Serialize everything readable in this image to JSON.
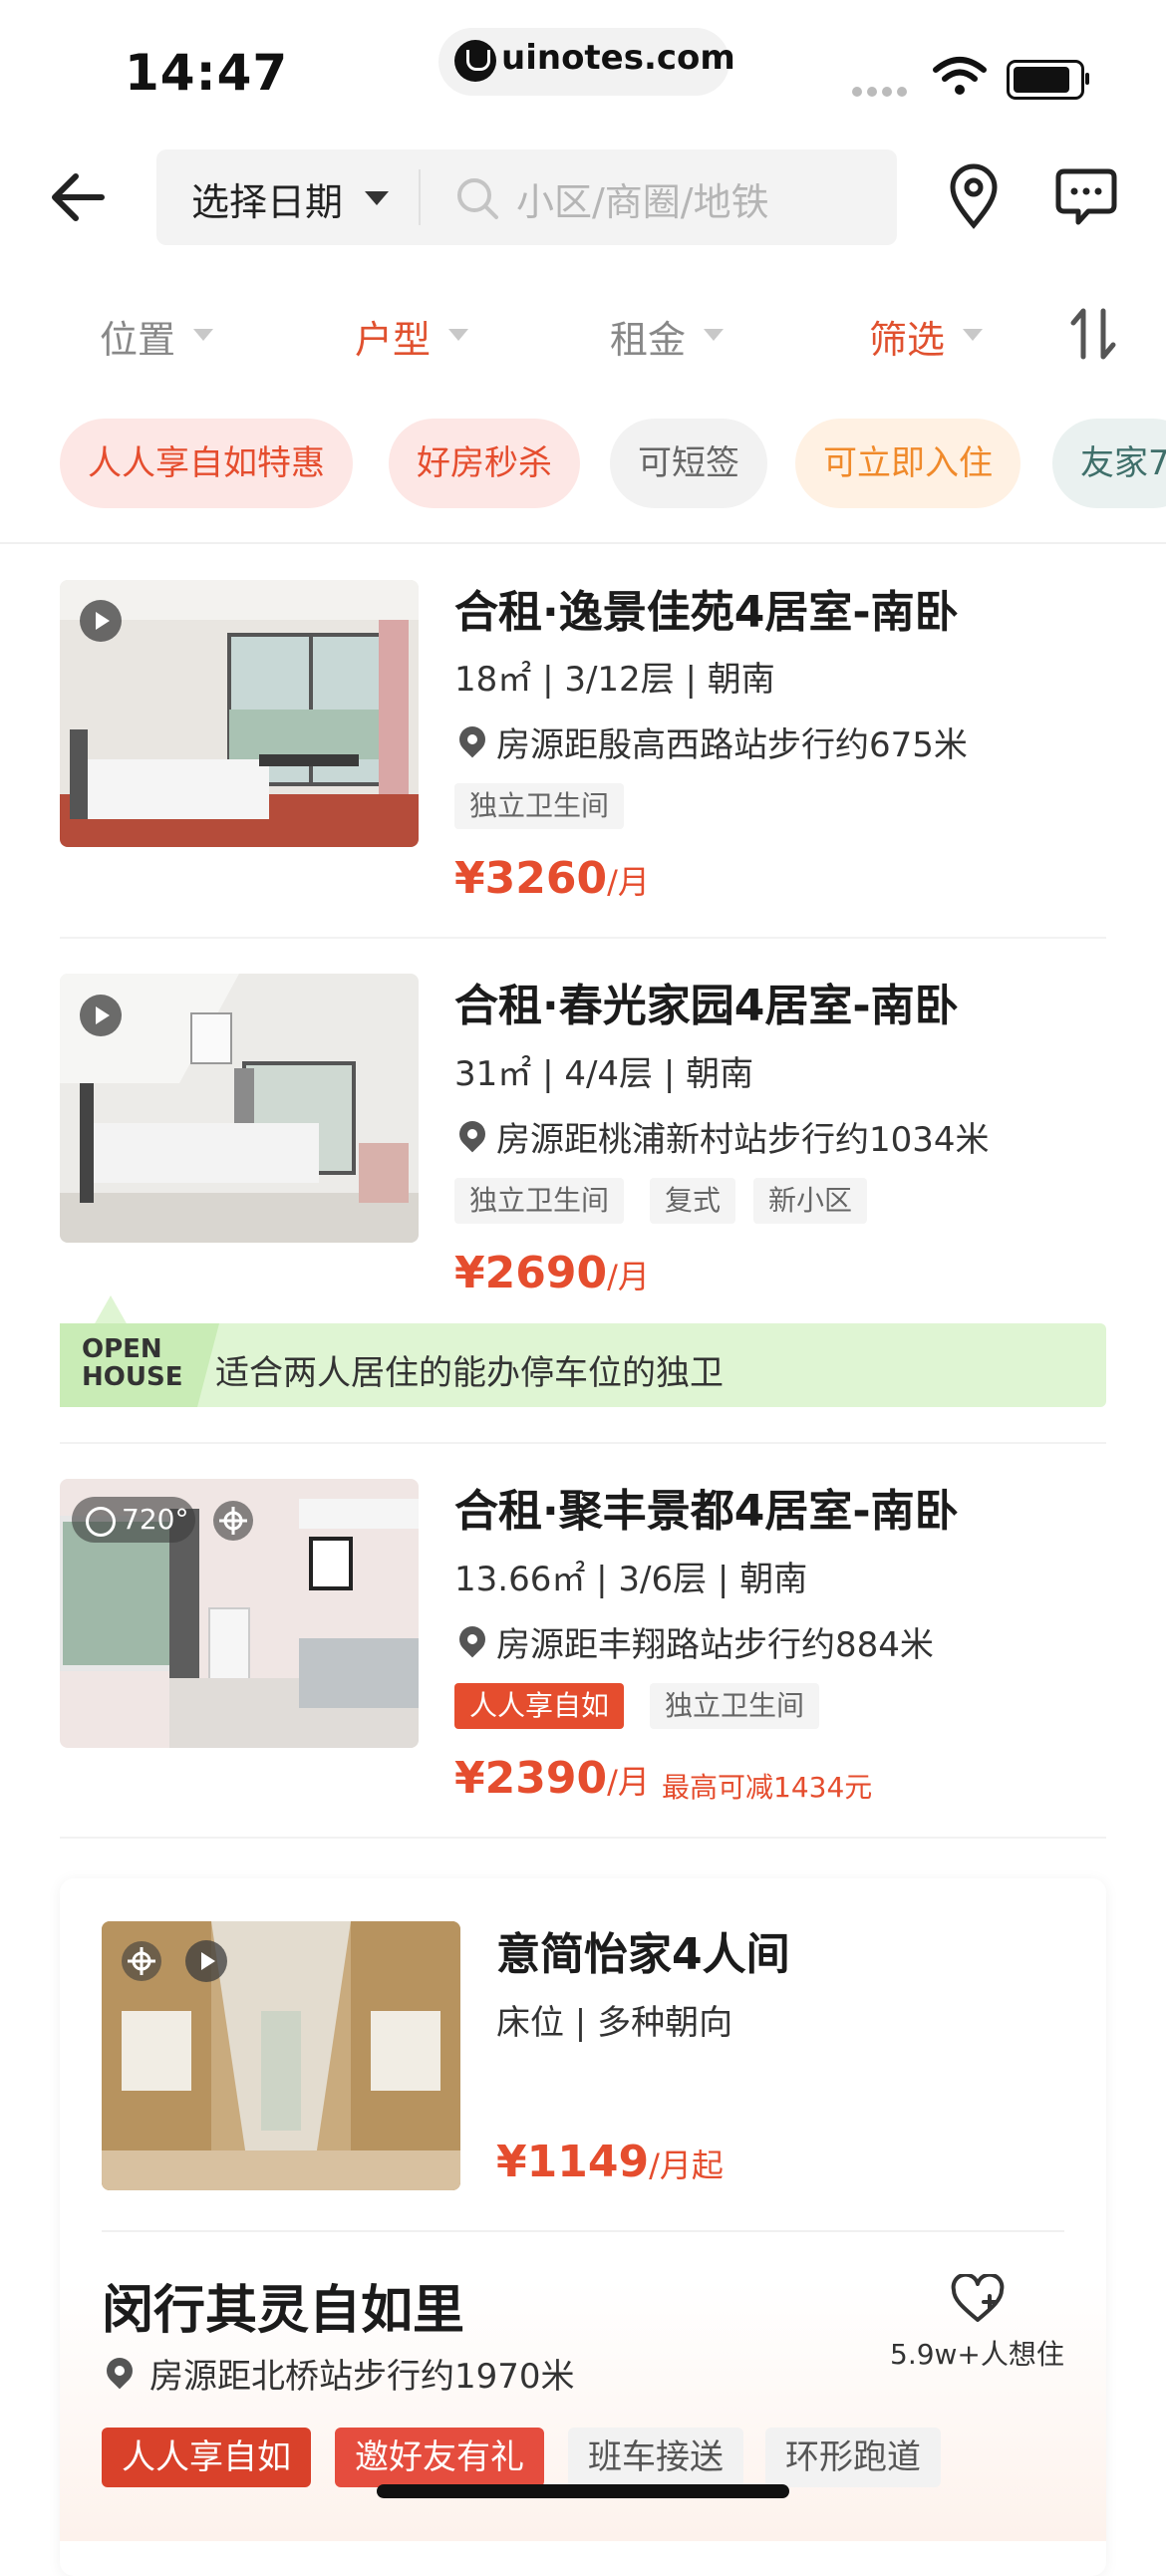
{
  "status": {
    "time": "14:47",
    "url": "uinotes.com"
  },
  "search": {
    "date_label": "选择日期",
    "placeholder": "小区/商圈/地铁"
  },
  "filters": [
    {
      "label": "位置",
      "color": "#888888"
    },
    {
      "label": "户型",
      "color": "#e0512f"
    },
    {
      "label": "租金",
      "color": "#888888"
    },
    {
      "label": "筛选",
      "color": "#e0512f"
    }
  ],
  "chips": [
    {
      "label": "人人享自如特惠",
      "bg": "#fde7e5",
      "fg": "#e54d2e"
    },
    {
      "label": "好房秒杀",
      "bg": "#fde7e5",
      "fg": "#e54d2e"
    },
    {
      "label": "可短签",
      "bg": "#f2f2f2",
      "fg": "#666666"
    },
    {
      "label": "可立即入住",
      "bg": "#fff1e3",
      "fg": "#f08a2b"
    },
    {
      "label": "友家7",
      "bg": "#eaf1f0",
      "fg": "#3f6f6a"
    }
  ],
  "listings": [
    {
      "title": "合租·逸景佳苑4居室-南卧",
      "spec": "18㎡ | 3/12层 | 朝南",
      "location": "房源距殷高西路站步行约675米",
      "tags": [
        "独立卫生间"
      ],
      "price": "¥3260",
      "unit": "/月"
    },
    {
      "title": "合租·春光家园4居室-南卧",
      "spec": "31㎡ | 4/4层 | 朝南",
      "location": "房源距桃浦新村站步行约1034米",
      "tags": [
        "独立卫生间",
        "复式",
        "新小区"
      ],
      "price": "¥2690",
      "unit": "/月",
      "openhouse_label_1": "OPEN",
      "openhouse_label_2": "HOUSE",
      "openhouse_text": "适合两人居住的能办停车位的独卫"
    },
    {
      "title": "合租·聚丰景都4居室-南卧",
      "spec": "13.66㎡ | 3/6层 | 朝南",
      "location": "房源距丰翔路站步行约884米",
      "tags": [
        "人人享自如",
        "独立卫生间"
      ],
      "price": "¥2390",
      "unit": "/月",
      "discount": "最高可减1434元",
      "vr_label": "720°"
    }
  ],
  "card": {
    "title": "意简怡家4人间",
    "spec": "床位 | 多种朝向",
    "price": "¥1149",
    "unit": "/月起",
    "community": "闵行其灵自如里",
    "location": "房源距北桥站步行约1970米",
    "want": "5.9w+人想住",
    "tags": [
      {
        "label": "人人享自如",
        "bg": "#d9412a",
        "fg": "#ffffff"
      },
      {
        "label": "邀好友有礼",
        "bg": "#e54d3e",
        "fg": "#ffffff"
      },
      {
        "label": "班车接送",
        "bg": "#f2f2f2",
        "fg": "#555555"
      },
      {
        "label": "环形跑道",
        "bg": "#f2f2f2",
        "fg": "#555555"
      }
    ]
  }
}
